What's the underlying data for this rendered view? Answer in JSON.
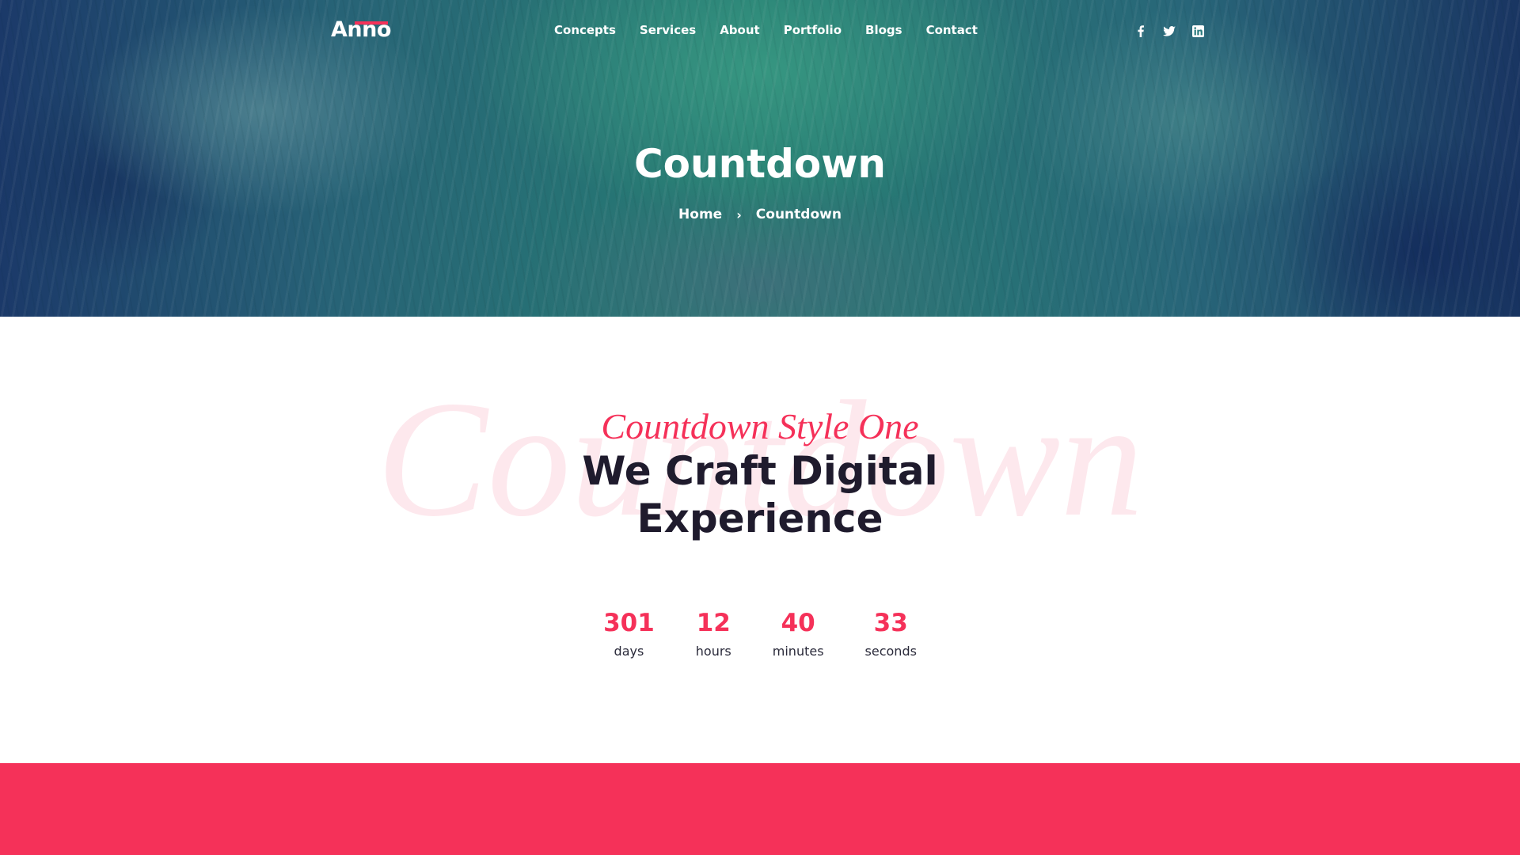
{
  "colors": {
    "accent": "#f53159",
    "heading": "#1f1b2d",
    "hero_text": "#ffffff",
    "band": "#f53159"
  },
  "header": {
    "logo": "Anno",
    "nav": [
      {
        "label": "Concepts"
      },
      {
        "label": "Services"
      },
      {
        "label": "About"
      },
      {
        "label": "Portfolio"
      },
      {
        "label": "Blogs"
      },
      {
        "label": "Contact"
      }
    ],
    "social": [
      {
        "icon": "facebook-icon"
      },
      {
        "icon": "twitter-icon"
      },
      {
        "icon": "linkedin-icon"
      }
    ]
  },
  "hero": {
    "title": "Countdown",
    "breadcrumb": {
      "home": "Home",
      "separator": "›",
      "current": "Countdown"
    }
  },
  "section": {
    "watermark": "Countdown",
    "subtitle": "Countdown Style One",
    "headline_line1": "We Craft Digital",
    "headline_line2": "Experience"
  },
  "countdown": [
    {
      "value": "301",
      "label": "days"
    },
    {
      "value": "12",
      "label": "hours"
    },
    {
      "value": "40",
      "label": "minutes"
    },
    {
      "value": "33",
      "label": "seconds"
    }
  ]
}
